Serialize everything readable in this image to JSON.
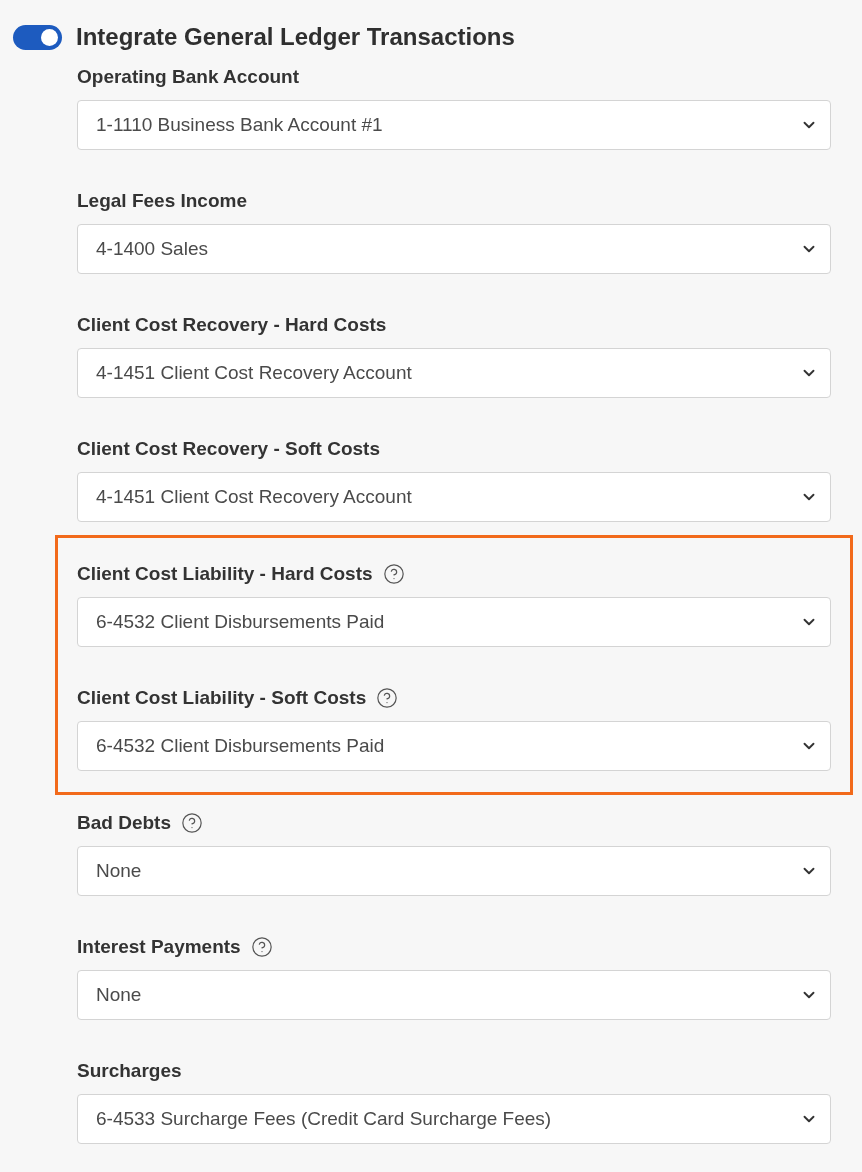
{
  "integrate": {
    "label": "Integrate General Ledger Transactions",
    "on": true
  },
  "fields": [
    {
      "label": "Operating Bank Account",
      "value": "1-1110 Business Bank Account #1",
      "help": false,
      "highlighted": false
    },
    {
      "label": "Legal Fees Income",
      "value": "4-1400 Sales",
      "help": false,
      "highlighted": false
    },
    {
      "label": "Client Cost Recovery - Hard Costs",
      "value": "4-1451 Client Cost Recovery Account",
      "help": false,
      "highlighted": false
    },
    {
      "label": "Client Cost Recovery - Soft Costs",
      "value": "4-1451 Client Cost Recovery Account",
      "help": false,
      "highlighted": false
    },
    {
      "label": "Client Cost Liability - Hard Costs",
      "value": "6-4532 Client Disbursements Paid",
      "help": true,
      "highlighted": true
    },
    {
      "label": "Client Cost Liability - Soft Costs",
      "value": "6-4532 Client Disbursements Paid",
      "help": true,
      "highlighted": true
    },
    {
      "label": "Bad Debts",
      "value": "None",
      "help": true,
      "highlighted": false
    },
    {
      "label": "Interest Payments",
      "value": "None",
      "help": true,
      "highlighted": false
    },
    {
      "label": "Surcharges",
      "value": "6-4533 Surcharge Fees (Credit Card Surcharge Fees)",
      "help": false,
      "highlighted": false
    }
  ]
}
